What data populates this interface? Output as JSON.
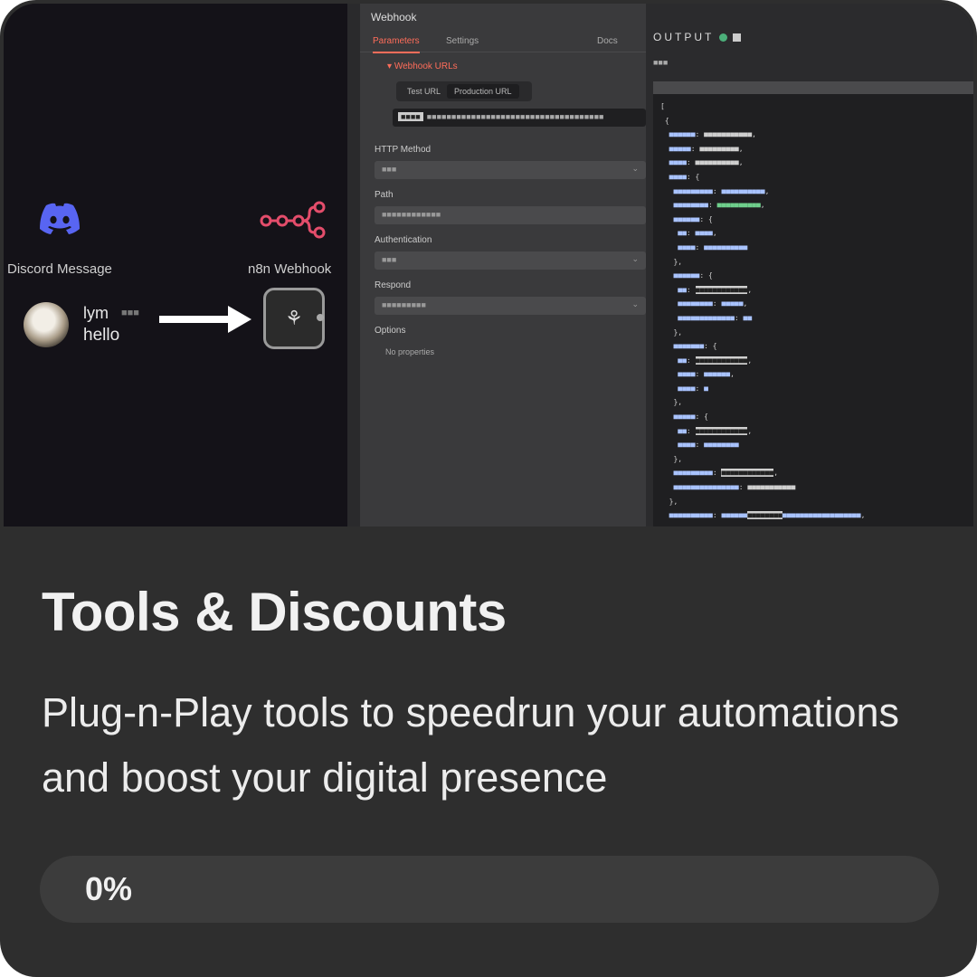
{
  "card": {
    "title": "Tools & Discounts",
    "description": "Plug-n-Play tools to speedrun your automations and boost your digital presence",
    "progress_label": "0%",
    "progress_fraction": 0.0
  },
  "preview": {
    "canvas": {
      "discord_node_label": "Discord Message",
      "n8n_node_label": "n8n Webhook",
      "message_user": "lym",
      "message_text": "hello",
      "discord_icon": "discord-icon",
      "n8n_icon": "n8n-icon",
      "arrow_icon": "arrow-right-icon",
      "webhook_icon": "webhook-icon"
    },
    "params_panel": {
      "title": "Webhook",
      "tabs": [
        "Parameters",
        "Settings",
        "Docs"
      ],
      "webhook_urls": "Webhook URLs",
      "url_tabs": [
        "Test URL",
        "Production URL"
      ],
      "fields": [
        "HTTP Method",
        "Path",
        "Authentication",
        "Respond",
        "Options"
      ],
      "no_properties": "No properties"
    },
    "output_panel": {
      "title": "OUTPUT"
    },
    "colors": {
      "discord_blue": "#5865f2",
      "n8n_pink": "#e44d6b",
      "accent_orange": "#ff6d5a",
      "status_green": "#4caf7a"
    }
  }
}
